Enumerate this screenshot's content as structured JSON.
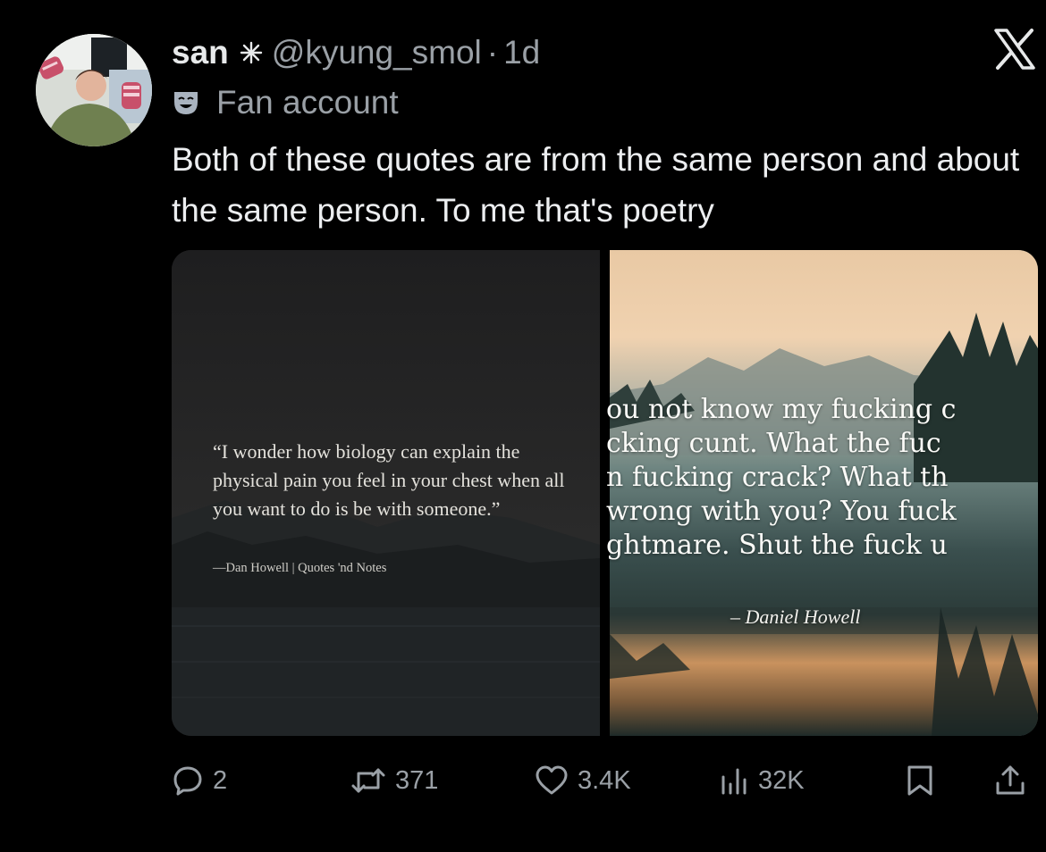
{
  "tweet": {
    "author_name": "san",
    "handle": "@kyung_smol",
    "separator": "·",
    "time": "1d",
    "badge_label": "Fan account",
    "text": "Both of these quotes are from the same person and about the same person. To me that's poetry"
  },
  "media": {
    "left": {
      "quote": "“I wonder how biology can explain the physical pain you feel in your chest when all you want to do is be with someone.”",
      "citation": "—Dan Howell | Quotes 'nd Notes"
    },
    "right": {
      "lines": [
        "ou not know my fucking c",
        "cking cunt. What the fuc",
        "n fucking crack? What th",
        "wrong with you? You fuck",
        "ghtmare. Shut the fuck u"
      ],
      "citation": "– Daniel Howell"
    }
  },
  "actions": {
    "replies": "2",
    "reposts": "371",
    "likes": "3.4K",
    "views": "32K"
  },
  "icons": {
    "verified_star": "sparkle-icon",
    "badge": "theater-mask-icon",
    "platform": "x-logo-icon",
    "reply": "reply-icon",
    "repost": "repost-icon",
    "like": "heart-icon",
    "views": "views-icon",
    "bookmark": "bookmark-icon",
    "share": "share-icon"
  },
  "colors": {
    "background": "#000000",
    "text": "#e7e9ea",
    "muted": "#9aa0a6"
  }
}
